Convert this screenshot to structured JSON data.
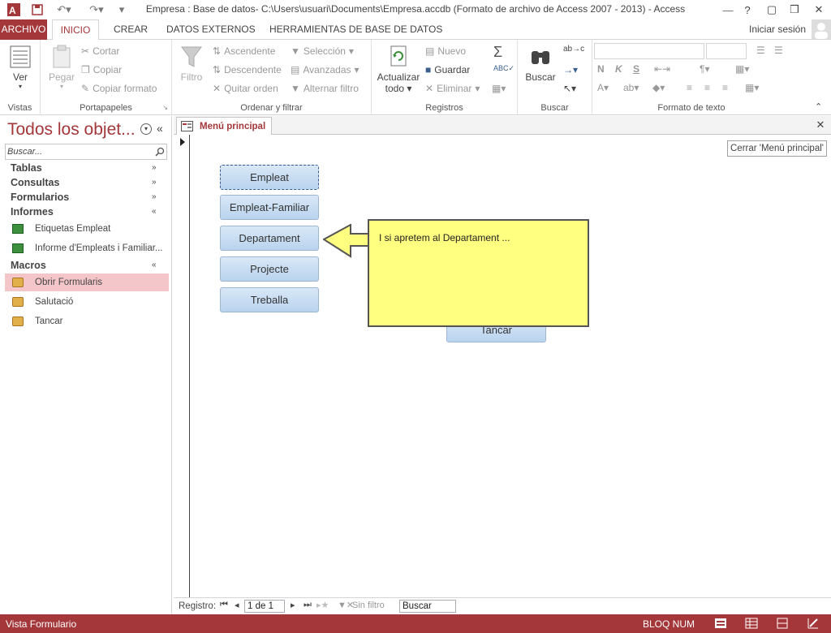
{
  "window": {
    "title": "Empresa : Base de datos- C:\\Users\\usuari\\Documents\\Empresa.accdb (Formato de archivo de Access 2007 - 2013) - Access",
    "help": "?",
    "controls": [
      "—",
      "❒",
      "✕"
    ]
  },
  "ribbon_tabs": [
    "ARCHIVO",
    "INICIO",
    "CREAR",
    "DATOS EXTERNOS",
    "HERRAMIENTAS DE BASE DE DATOS"
  ],
  "signin": "Iniciar sesión",
  "ribbon": {
    "vistas": {
      "ver": "Ver",
      "label": "Vistas"
    },
    "portapapeles": {
      "pegar": "Pegar",
      "cortar": "Cortar",
      "copiar": "Copiar",
      "copiar_formato": "Copiar formato",
      "label": "Portapapeles"
    },
    "ordenar": {
      "filtro": "Filtro",
      "ascendente": "Ascendente",
      "descendente": "Descendente",
      "quitar_orden": "Quitar orden",
      "seleccion": "Selección",
      "avanzadas": "Avanzadas",
      "alternar_filtro": "Alternar filtro",
      "label": "Ordenar y filtrar"
    },
    "registros": {
      "actualizar": "Actualizar",
      "todo": "todo",
      "nuevo": "Nuevo",
      "guardar": "Guardar",
      "eliminar": "Eliminar",
      "label": "Registros"
    },
    "buscar": {
      "buscar": "Buscar",
      "label": "Buscar"
    },
    "formato": {
      "n": "N",
      "k": "K",
      "s": "S",
      "label": "Formato de texto"
    }
  },
  "nav": {
    "header": "Todos los objet...",
    "search_placeholder": "Buscar...",
    "categories": [
      {
        "label": "Tablas",
        "chev": "»"
      },
      {
        "label": "Consultas",
        "chev": "»"
      },
      {
        "label": "Formularios",
        "chev": "»"
      },
      {
        "label": "Informes",
        "chev": "«"
      },
      {
        "label": "Macros",
        "chev": "«"
      }
    ],
    "informes": [
      "Etiquetas Empleat",
      "Informe d'Empleats i Familiar..."
    ],
    "macros": [
      "Obrir Formularis",
      "Salutació",
      "Tancar"
    ]
  },
  "document": {
    "tab_label": "Menú principal",
    "close_tooltip": "Cerrar 'Menú principal'",
    "buttons": [
      "Empleat",
      "Empleat-Familiar",
      "Departament",
      "Projecte",
      "Treballa",
      "Tancar"
    ],
    "callout": "I si apretem al Departament ...",
    "recnav": {
      "label": "Registro:",
      "position": "1 de 1",
      "filter": "Sin filtro",
      "search": "Buscar"
    }
  },
  "status": {
    "left": "Vista Formulario",
    "right": "BLOQ NUM"
  },
  "colors": {
    "accent": "#a4373a",
    "callout": "#ffff80",
    "button": "#c9ddf2"
  }
}
